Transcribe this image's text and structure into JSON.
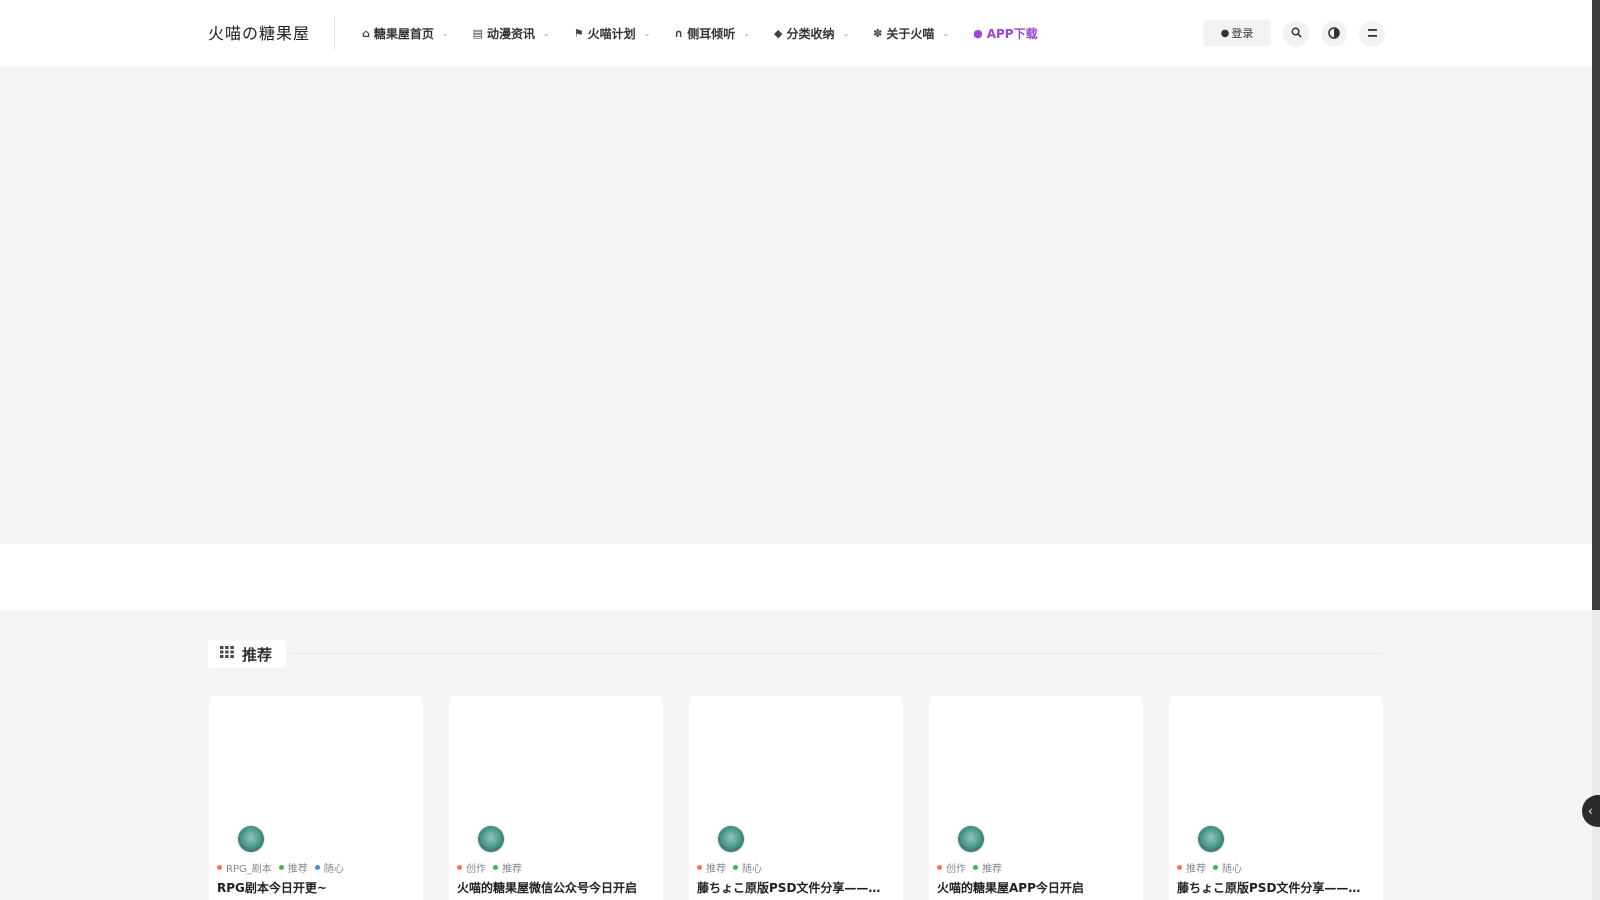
{
  "header": {
    "logo": "火喵の糖果屋",
    "nav": [
      {
        "label": "糖果屋首页",
        "icon": "home-icon",
        "glyph": "⌂",
        "has_dropdown": true
      },
      {
        "label": "动漫资讯",
        "icon": "newspaper-icon",
        "glyph": "▤",
        "has_dropdown": true
      },
      {
        "label": "火喵计划",
        "icon": "flag-icon",
        "glyph": "⚑",
        "has_dropdown": true
      },
      {
        "label": "侧耳倾听",
        "icon": "headphones-icon",
        "glyph": "∩",
        "has_dropdown": true
      },
      {
        "label": "分类收纳",
        "icon": "tags-icon",
        "glyph": "◆",
        "has_dropdown": true
      },
      {
        "label": "关于火喵",
        "icon": "paw-icon",
        "glyph": "✽",
        "has_dropdown": true
      },
      {
        "label": "APP下载",
        "icon": "android-icon",
        "glyph": "●",
        "has_dropdown": false
      }
    ],
    "login_label": "登录",
    "login_icon": "user-icon",
    "search_icon": "search-icon",
    "theme_icon": "contrast-icon",
    "menu_icon": "menu-icon"
  },
  "section": {
    "title": "推荐",
    "icon": "grid-icon"
  },
  "colors": {
    "accent_purple": "#9b46d6",
    "dot_orange": "#f07f3c",
    "dot_green": "#4caf50",
    "dot_blue": "#3b8fe0"
  },
  "cards": [
    {
      "title": "RPG剧本今日开更~",
      "tags": [
        {
          "label": "RPG_剧本",
          "color": "#f07f3c"
        },
        {
          "label": "推荐",
          "color": "#4caf50"
        },
        {
          "label": "随心",
          "color": "#3b8fe0"
        }
      ]
    },
    {
      "title": "火喵的糖果屋微信公众号今日开启",
      "tags": [
        {
          "label": "创作",
          "color": "#f07f3c"
        },
        {
          "label": "推荐",
          "color": "#4caf50"
        }
      ]
    },
    {
      "title": "藤ちょこ原版PSD文件分享——…",
      "tags": [
        {
          "label": "推荐",
          "color": "#f07f3c"
        },
        {
          "label": "随心",
          "color": "#4caf50"
        }
      ]
    },
    {
      "title": "火喵的糖果屋APP今日开启",
      "tags": [
        {
          "label": "创作",
          "color": "#f07f3c"
        },
        {
          "label": "推荐",
          "color": "#4caf50"
        }
      ]
    },
    {
      "title": "藤ちょこ原版PSD文件分享——…",
      "tags": [
        {
          "label": "推荐",
          "color": "#f07f3c"
        },
        {
          "label": "随心",
          "color": "#4caf50"
        }
      ]
    }
  ]
}
